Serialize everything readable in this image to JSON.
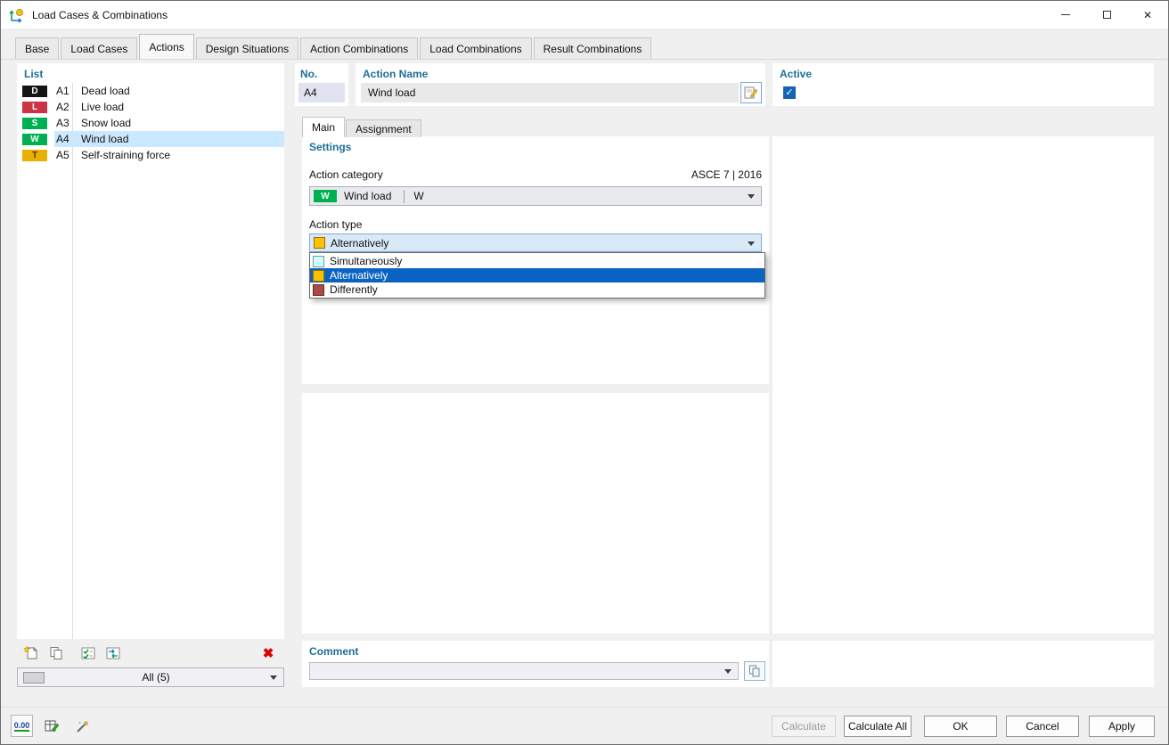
{
  "window": {
    "title": "Load Cases & Combinations"
  },
  "icons": {
    "minimize": "–",
    "close": "✕",
    "delete": "✖",
    "check": "✓",
    "units": "0.00"
  },
  "tabs": [
    {
      "label": "Base",
      "active": false
    },
    {
      "label": "Load Cases",
      "active": false
    },
    {
      "label": "Actions",
      "active": true
    },
    {
      "label": "Design Situations",
      "active": false
    },
    {
      "label": "Action Combinations",
      "active": false
    },
    {
      "label": "Load Combinations",
      "active": false
    },
    {
      "label": "Result Combinations",
      "active": false
    }
  ],
  "list": {
    "header": "List",
    "items": [
      {
        "badge": "D",
        "badge_color": "#141414",
        "badge_text": "#ffffff",
        "id": "A1",
        "name": "Dead load",
        "selected": false
      },
      {
        "badge": "L",
        "badge_color": "#cc3344",
        "badge_text": "#ffffff",
        "id": "A2",
        "name": "Live load",
        "selected": false
      },
      {
        "badge": "S",
        "badge_color": "#00b050",
        "badge_text": "#ffffff",
        "id": "A3",
        "name": "Snow load",
        "selected": false
      },
      {
        "badge": "W",
        "badge_color": "#00b050",
        "badge_text": "#ffffff",
        "id": "A4",
        "name": "Wind load",
        "selected": true
      },
      {
        "badge": "T",
        "badge_color": "#eab000",
        "badge_text": "#4a3a00",
        "id": "A5",
        "name": "Self-straining force",
        "selected": false
      }
    ],
    "filter_value": "All (5)"
  },
  "details": {
    "no_label": "No.",
    "no_value": "A4",
    "name_label": "Action Name",
    "name_value": "Wind load",
    "active_label": "Active",
    "active_checked": true
  },
  "subtabs": [
    {
      "label": "Main",
      "active": true
    },
    {
      "label": "Assignment",
      "active": false
    }
  ],
  "settings": {
    "header": "Settings",
    "category_label": "Action category",
    "standard": "ASCE 7 | 2016",
    "category": {
      "badge": "W",
      "badge_color": "#00b050",
      "name": "Wind load",
      "symbol": "W"
    },
    "type_label": "Action type",
    "type_value": {
      "label": "Alternatively",
      "color": "#ffc000"
    },
    "type_options": [
      {
        "label": "Simultaneously",
        "color": "#ccffff",
        "selected": false
      },
      {
        "label": "Alternatively",
        "color": "#ffc000",
        "selected": true
      },
      {
        "label": "Differently",
        "color": "#a94a44",
        "selected": false
      }
    ]
  },
  "comment": {
    "header": "Comment",
    "value": ""
  },
  "footer": {
    "calculate": "Calculate",
    "calculate_all": "Calculate All",
    "ok": "OK",
    "cancel": "Cancel",
    "apply": "Apply"
  },
  "colors": {
    "selection": "#cce8ff",
    "highlight": "#0a63c2",
    "accent": "#1464b4",
    "header_text": "#1d6f93"
  }
}
